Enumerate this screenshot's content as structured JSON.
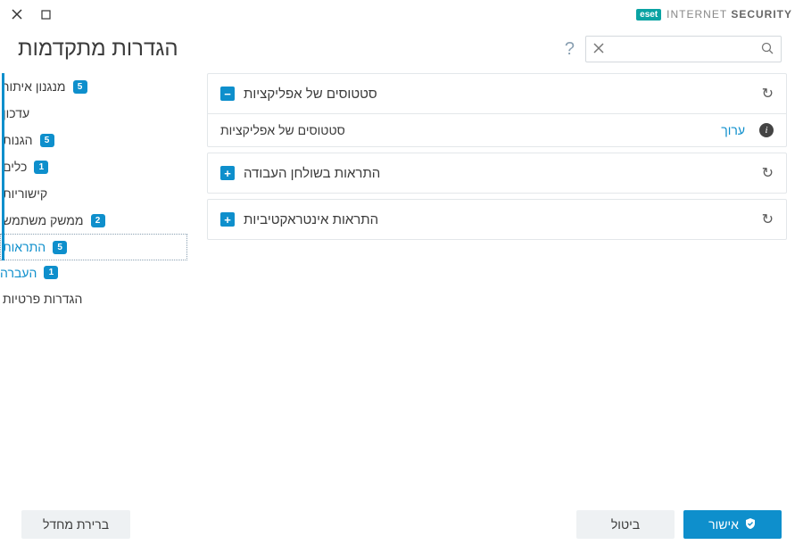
{
  "brand": {
    "logo": "eset",
    "text_light": "INTERNET",
    "text_bold": "SECURITY"
  },
  "page_title": "הגדרות מתקדמות",
  "search": {
    "value": "",
    "placeholder": ""
  },
  "sidebar": {
    "items": [
      {
        "label": "מנגנון איתור",
        "badge": "5",
        "accent": true
      },
      {
        "label": "עדכון",
        "badge": "",
        "accent": true
      },
      {
        "label": "הגנות",
        "badge": "5",
        "accent": true
      },
      {
        "label": "כלים",
        "badge": "1",
        "accent": true
      },
      {
        "label": "קישוריות",
        "badge": "",
        "accent": true
      },
      {
        "label": "ממשק משתמש",
        "badge": "2",
        "accent": true
      },
      {
        "label": "התראות",
        "badge": "5",
        "accent": true,
        "selected": true
      },
      {
        "label": "הגדרות פרטיות",
        "badge": "",
        "accent": false
      }
    ],
    "sub": {
      "label": "העברה",
      "badge": "1"
    }
  },
  "panels": [
    {
      "title": "סטטוסים של אפליקציות",
      "expanded": true,
      "row": {
        "label": "סטטוסים של אפליקציות",
        "action": "ערוך"
      }
    },
    {
      "title": "התראות בשולחן העבודה",
      "expanded": false
    },
    {
      "title": "התראות אינטראקטיביות",
      "expanded": false
    }
  ],
  "footer": {
    "default": "ברירת מחדל",
    "ok": "אישור",
    "cancel": "ביטול"
  }
}
